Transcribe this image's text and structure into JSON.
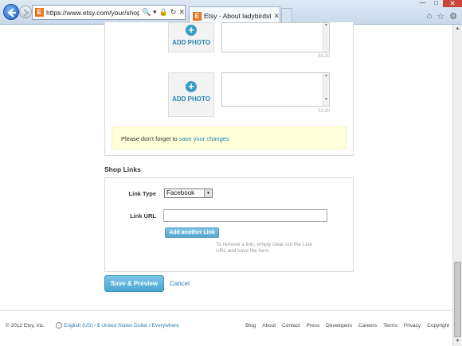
{
  "browser": {
    "url": "https://www.etsy.com/your/shops/ladybirdst",
    "tab_title": "Etsy - About ladybirdstitch...",
    "favicon_letter": "E",
    "addr_icons": [
      "🔍",
      "▾",
      "🔒",
      "↻",
      "✕"
    ],
    "tab_close": "✕",
    "window_controls": {
      "minimize": "—",
      "maximize": "□",
      "close": "✕"
    },
    "toolbar_icons": [
      "⌂",
      "☆",
      "⚙"
    ]
  },
  "photos": [
    {
      "label": "ADD PHOTO",
      "counter": "0/120"
    },
    {
      "label": "ADD PHOTO",
      "counter": "0/120"
    }
  ],
  "notice": {
    "text": "Please don't forget to ",
    "link": "save your changes"
  },
  "shop_links": {
    "section_title": "Shop Links",
    "link_type_label": "Link Type",
    "link_type_value": "Facebook",
    "link_url_label": "Link URL",
    "link_url_value": "",
    "add_button": "Add another Link",
    "hint": "To remove a link, simply clear out the Link URL and save the form"
  },
  "actions": {
    "save_preview": "Save & Preview",
    "cancel": "Cancel"
  },
  "footer": {
    "copyright": "© 2012 Etsy, Inc.",
    "locale": "English (US) / $ United States Dollar / Everywhere",
    "links": [
      "Blog",
      "About",
      "Contact",
      "Press",
      "Developers",
      "Careers",
      "Terms",
      "Privacy",
      "Copyright"
    ]
  },
  "colors": {
    "accent": "#3a9dc7",
    "link": "#2a7eb4",
    "notice_bg": "#ffffd9"
  }
}
